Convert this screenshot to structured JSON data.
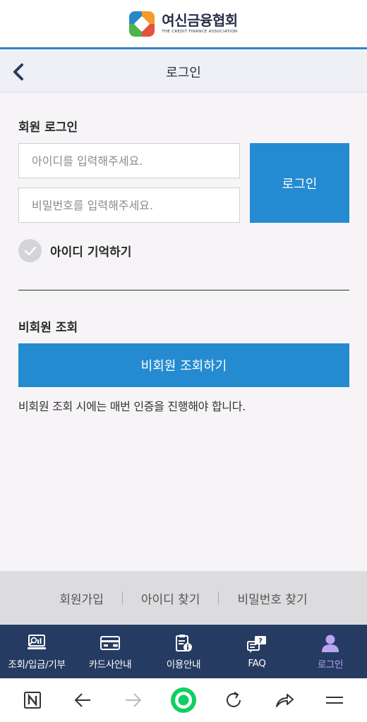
{
  "brand": {
    "name_kr": "여신금융협회",
    "name_en": "THE CREDIT FINANCE ASSOCIATION"
  },
  "header": {
    "title": "로그인",
    "back_icon": "chevron-left-icon"
  },
  "member_login": {
    "section_title": "회원 로그인",
    "id_placeholder": "아이디를 입력해주세요.",
    "password_placeholder": "비밀번호를 입력해주세요.",
    "login_button": "로그인",
    "remember_label": "아이디 기억하기",
    "remember_checked": false
  },
  "guest": {
    "section_title": "비회원 조회",
    "button_label": "비회원 조회하기",
    "note": "비회원 조회 시에는 매번 인증을 진행해야 합니다."
  },
  "footer_links": [
    {
      "label": "회원가입"
    },
    {
      "label": "아이디 찾기"
    },
    {
      "label": "비밀번호 찾기"
    }
  ],
  "bottom_nav": [
    {
      "label": "조회/입금/기부",
      "icon": "inquiry-icon"
    },
    {
      "label": "카드사안내",
      "icon": "card-icon"
    },
    {
      "label": "이용안내",
      "icon": "guide-icon"
    },
    {
      "label": "FAQ",
      "icon": "faq-icon"
    },
    {
      "label": "로그인",
      "icon": "user-icon",
      "active": true
    }
  ],
  "browser_bar": [
    "naver-icon",
    "back-arrow-icon",
    "forward-arrow-icon",
    "home-icon",
    "refresh-icon",
    "share-icon",
    "menu-icon"
  ],
  "colors": {
    "primary_blue": "#258bd0",
    "nav_bg": "#263b62",
    "nav_active": "#b7a6f2",
    "browser_green": "#0fcf63"
  }
}
